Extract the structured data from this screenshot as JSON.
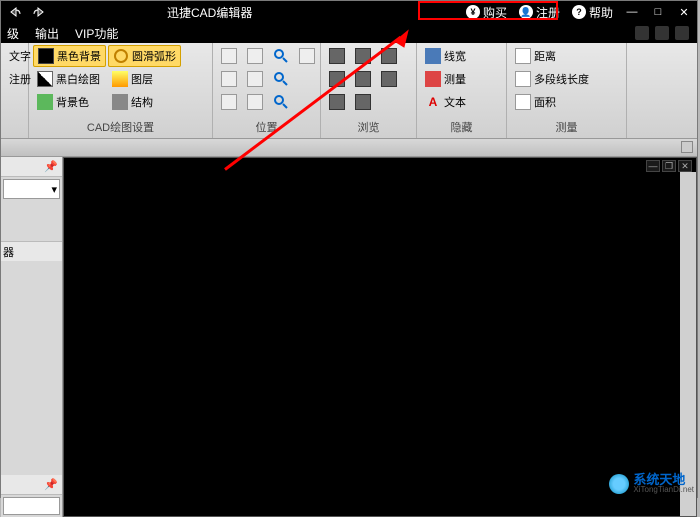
{
  "title": "迅捷CAD编辑器",
  "titlebar": {
    "buy": "购买",
    "register": "注册",
    "help": "帮助"
  },
  "menu": {
    "level": "级",
    "output": "输出",
    "vip": "VIP功能"
  },
  "ribbon": {
    "edit": {
      "text": "文字",
      "register": "注册"
    },
    "cad_settings": {
      "label": "CAD绘图设置",
      "black_bg": "黑色背景",
      "smooth_arc": "圆滑弧形",
      "bw_draw": "黑白绘图",
      "layers": "图层",
      "bg_color": "背景色",
      "structure": "结构"
    },
    "position": {
      "label": "位置"
    },
    "browse": {
      "label": "浏览"
    },
    "hide": {
      "label": "隐藏",
      "line_width": "线宽",
      "measure": "测量",
      "text": "文本"
    },
    "measure": {
      "label": "测量",
      "distance": "距离",
      "polyline": "多段线长度",
      "area": "面积"
    }
  },
  "sidepanel": {
    "tab_suffix": "器"
  },
  "watermark": {
    "cn": "系统天地",
    "en": "XiTongTianDi.net"
  }
}
